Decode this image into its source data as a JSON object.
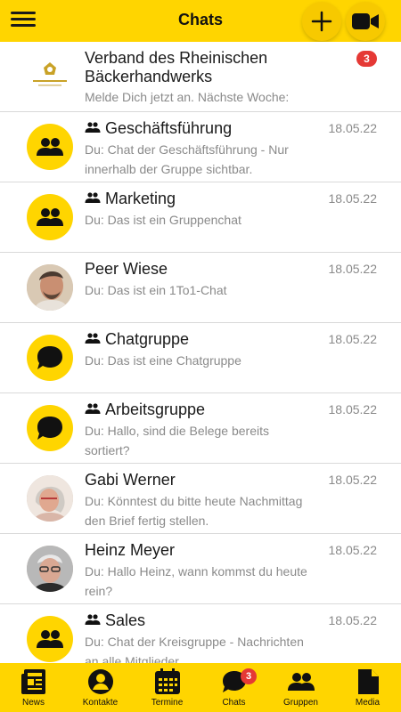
{
  "header": {
    "title": "Chats",
    "menu_icon": "hamburger-menu-icon",
    "add_icon": "plus-icon",
    "video_icon": "video-camera-icon",
    "accent": "#ffd500"
  },
  "chats": [
    {
      "name": "Verband des Rheinischen Bäckerhandwerks",
      "message": "Melde Dich jetzt an. Nächste Woche:",
      "badge": "3",
      "avatar": "logo"
    },
    {
      "name": "Geschäftsführung",
      "message": "Du: Chat der Geschäftsführung - Nur innerhalb der Gruppe sichtbar.",
      "date": "18.05.22",
      "avatar": "group-icon"
    },
    {
      "name": "Marketing",
      "message": "Du: Das ist ein Gruppenchat",
      "date": "18.05.22",
      "avatar": "group-icon"
    },
    {
      "name": "Peer Wiese",
      "message": "Du: Das ist ein 1To1-Chat",
      "date": "18.05.22",
      "avatar": "photo"
    },
    {
      "name": "Chatgruppe",
      "message": "Du: Das ist eine Chatgruppe",
      "date": "18.05.22",
      "avatar": "chat-bubble-icon"
    },
    {
      "name": "Arbeitsgruppe",
      "message": "Du: Hallo, sind die Belege bereits sortiert?",
      "date": "18.05.22",
      "avatar": "chat-bubble-icon"
    },
    {
      "name": "Gabi Werner",
      "message": "Du: Könntest du bitte heute Nachmittag den Brief fertig stellen.",
      "date": "18.05.22",
      "avatar": "photo"
    },
    {
      "name": "Heinz Meyer",
      "message": "Du: Hallo Heinz, wann kommst du heute rein?",
      "date": "18.05.22",
      "avatar": "photo"
    },
    {
      "name": "Sales",
      "message": "Du: Chat der Kreisgruppe - Nachrichten an alle Mitglieder",
      "date": "18.05.22",
      "avatar": "group-icon"
    }
  ],
  "nav": [
    {
      "label": "News",
      "icon": "newspaper-icon"
    },
    {
      "label": "Kontakte",
      "icon": "contact-icon"
    },
    {
      "label": "Termine",
      "icon": "calendar-icon"
    },
    {
      "label": "Chats",
      "icon": "chat-bubble-icon",
      "badge": "3"
    },
    {
      "label": "Gruppen",
      "icon": "group-icon"
    },
    {
      "label": "Media",
      "icon": "document-icon"
    }
  ]
}
